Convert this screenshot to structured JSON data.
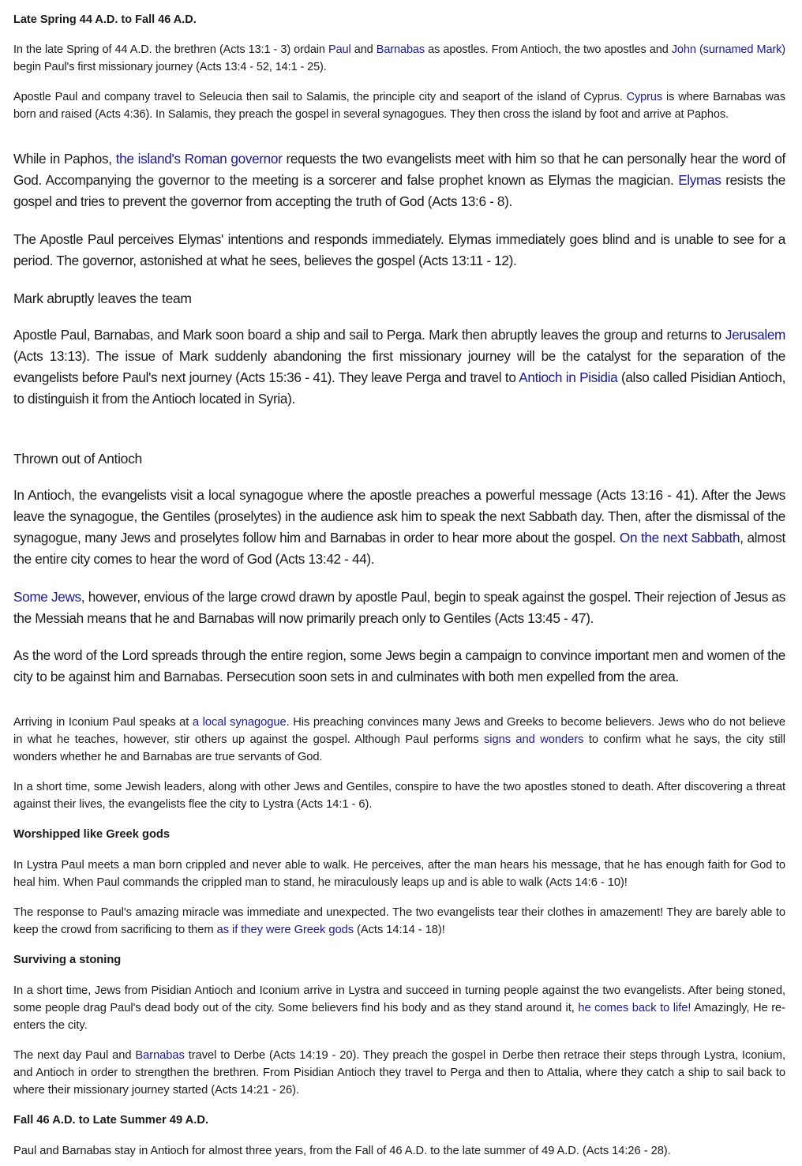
{
  "headings": {
    "h1": "Late Spring 44 A.D. to Fall 46 A.D.",
    "h2": "Mark abruptly leaves the team",
    "h3": "Thrown out of Antioch",
    "h4": "Worshipped like Greek gods",
    "h5": "Surviving a stoning",
    "h6": "Fall 46 A.D. to Late Summer 49 A.D."
  },
  "p1": {
    "t1": "In the late Spring of 44 A.D. the brethren (Acts 13:1 - 3) ordain ",
    "l1": "Paul",
    "t2": " and ",
    "l2": "Barnabas",
    "t3": " as apostles. From Antioch, the two apostles and ",
    "l3": "John (surnamed Mark)",
    "t4": " begin Paul's first missionary journey (Acts 13:4 - 52, 14:1 - 25)."
  },
  "p2": {
    "t1": "Apostle Paul and company travel to Seleucia then sail to Salamis, the principle city and seaport of the island of Cyprus. ",
    "l1": "Cyprus",
    "t2": " is where Barnabas was born and raised (Acts 4:36). In Salamis, they preach the gospel in several synagogues. They then cross the island by foot and arrive at Paphos."
  },
  "p3": {
    "t1": "While in Paphos, ",
    "l1": "the island's Roman governor",
    "t2": " requests the two evangelists meet with him so that he can personally hear the word of God. Accompanying the governor to the meeting is a sorcerer and false prophet known as Elymas the magician. ",
    "l2": "Elymas",
    "t3": " resists the gospel and tries to prevent the governor from accepting the truth of God (Acts 13:6 - 8)."
  },
  "p4": "The Apostle Paul perceives Elymas' intentions and responds immediately. Elymas immediately goes blind and is unable to see for a period. The governor, astonished at what he sees, believes the gospel (Acts 13:11 - 12).",
  "p5": {
    "t1": "Apostle Paul, Barnabas, and Mark soon board a ship and sail to Perga. Mark then abruptly leaves the group and returns to ",
    "l1": "Jerusalem",
    "t2": " (Acts 13:13). The issue of Mark suddenly abandoning the first missionary journey will be the catalyst for the separation of the evangelists before Paul's next journey (Acts 15:36 - 41). They leave Perga and travel to ",
    "l2": "Antioch in Pisidia",
    "t3": " (also called Pisidian Antioch, to distinguish it from the Antioch located in Syria)."
  },
  "p6": {
    "t1": "In Antioch, the evangelists visit a local synagogue where the apostle preaches a powerful message (Acts 13:16 - 41). After the Jews leave the synagogue, the Gentiles (proselytes) in the audience ask him to speak the next Sabbath day. Then, after the dismissal of the synagogue, many Jews and proselytes follow him and Barnabas in order to hear more about the gospel. ",
    "l1": "On the next Sabbath",
    "t2": ", almost the entire city comes to hear the word of God (Acts 13:42 - 44)."
  },
  "p7": {
    "l1": "Some Jews",
    "t1": ", however, envious of the large crowd drawn by apostle Paul, begin to speak against the gospel. Their rejection of Jesus as the Messiah means that he and Barnabas will now primarily preach only to Gentiles (Acts 13:45 - 47)."
  },
  "p8": "As the word of the Lord spreads through the entire region, some Jews begin a campaign to convince important men and women of the city to be against him and Barnabas. Persecution soon sets in and culminates with both men expelled from the area.",
  "p9": {
    "t1": "Arriving in Iconium Paul speaks at ",
    "l1": "a local synagogue",
    "t2": ". His preaching convinces many Jews and Greeks to become believers. Jews who do not believe in what he teaches, however, stir others up against the gospel. Although Paul performs ",
    "l2": "signs and wonders",
    "t3": " to confirm what he says, the city still wonders whether he and Barnabas are true servants of God."
  },
  "p10": "In a short time, some Jewish leaders, along with other Jews and Gentiles, conspire to have the two apostles stoned to death. After discovering a threat against their lives, the evangelists flee the city to Lystra (Acts 14:1 - 6).",
  "p11": "In Lystra Paul meets a man born crippled and never able to walk. He perceives, after the man hears his message, that he has enough faith for God to heal him. When Paul commands the crippled man to stand, he miraculously leaps up and is able to walk (Acts 14:6 - 10)!",
  "p12": {
    "t1": "The response to Paul's amazing miracle was immediate and unexpected. The two evangelists tear their clothes in amazement! They are barely able to keep the crowd from sacrificing to them ",
    "l1": "as if they were Greek gods",
    "t2": " (Acts 14:14 - 18)!"
  },
  "p13": {
    "t1": "In a short time, Jews from Pisidian Antioch and Iconium arrive in Lystra and succeed in turning people against the two evangelists. After being stoned, some people drag Paul's dead body out of the city. Some believers find his body and as they stand around it, ",
    "l1": "he comes back to life!",
    "t2": " Amazingly, He re-enters the city."
  },
  "p14": {
    "t1": "The next day Paul and ",
    "l1": "Barnabas",
    "t2": " travel to Derbe (Acts 14:19 - 20). They preach the gospel in Derbe then retrace their steps through Lystra, Iconium, and Antioch in order to strengthen the brethren. From Pisidian Antioch they travel to Perga and then to Attalia, where they catch a ship to sail back to where their missionary journey started (Acts 14:21 - 26)."
  },
  "p15": "Paul and Barnabas stay in Antioch for almost three years, from the Fall of 46 A.D. to the late summer of 49 A.D. (Acts 14:26 - 28)."
}
